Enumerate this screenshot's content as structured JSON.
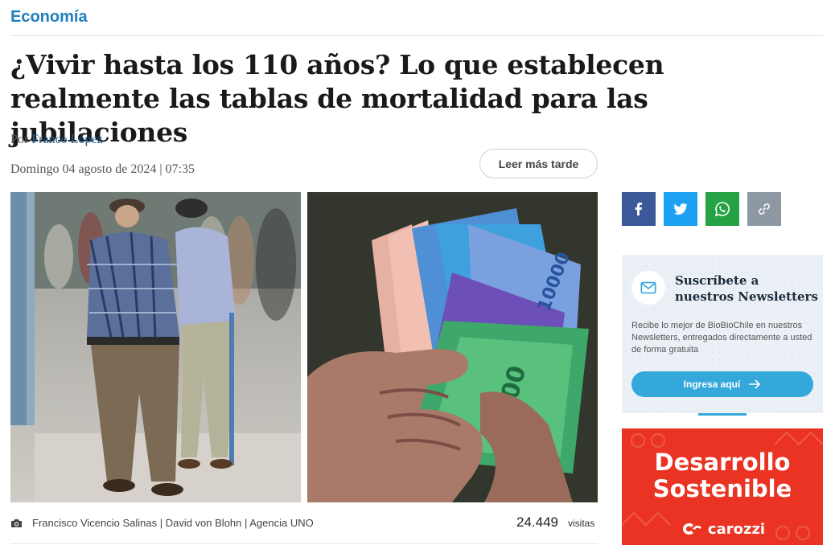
{
  "section": {
    "label": "Economía"
  },
  "article": {
    "title": "¿Vivir hasta los 110 años? Lo que establecen realmente las tablas de mortalidad para las jubilaciones",
    "byline_prefix": "Por",
    "author": "Franco López",
    "date": "Domingo 04 agosto de 2024 | 07:35",
    "read_later_label": "Leer más tarde",
    "photo_credit": "Francisco Vicencio Salinas | David von Blohn | Agencia UNO",
    "visits_count": "24.449",
    "visits_label": "visitas"
  },
  "share": {
    "icons": [
      "facebook-icon",
      "twitter-icon",
      "whatsapp-icon",
      "link-icon"
    ],
    "colors": {
      "facebook": "#3b5998",
      "twitter": "#1da1f2",
      "whatsapp": "#25a244",
      "link": "#8e98a3"
    }
  },
  "newsletter": {
    "title": "Suscríbete a nuestros Newsletters",
    "description": "Recibe lo mejor de BioBioChile en nuestros Newsletters, entregados directamente a usted de forma gratuita",
    "button_label": "Ingresa aquí"
  },
  "ad": {
    "line1": "Desarrollo",
    "line2": "Sostenible",
    "brand": "carozzi",
    "color": "#ea3323"
  },
  "colors": {
    "accent": "#1e7fc0",
    "newsletter_button": "#34a7db"
  }
}
